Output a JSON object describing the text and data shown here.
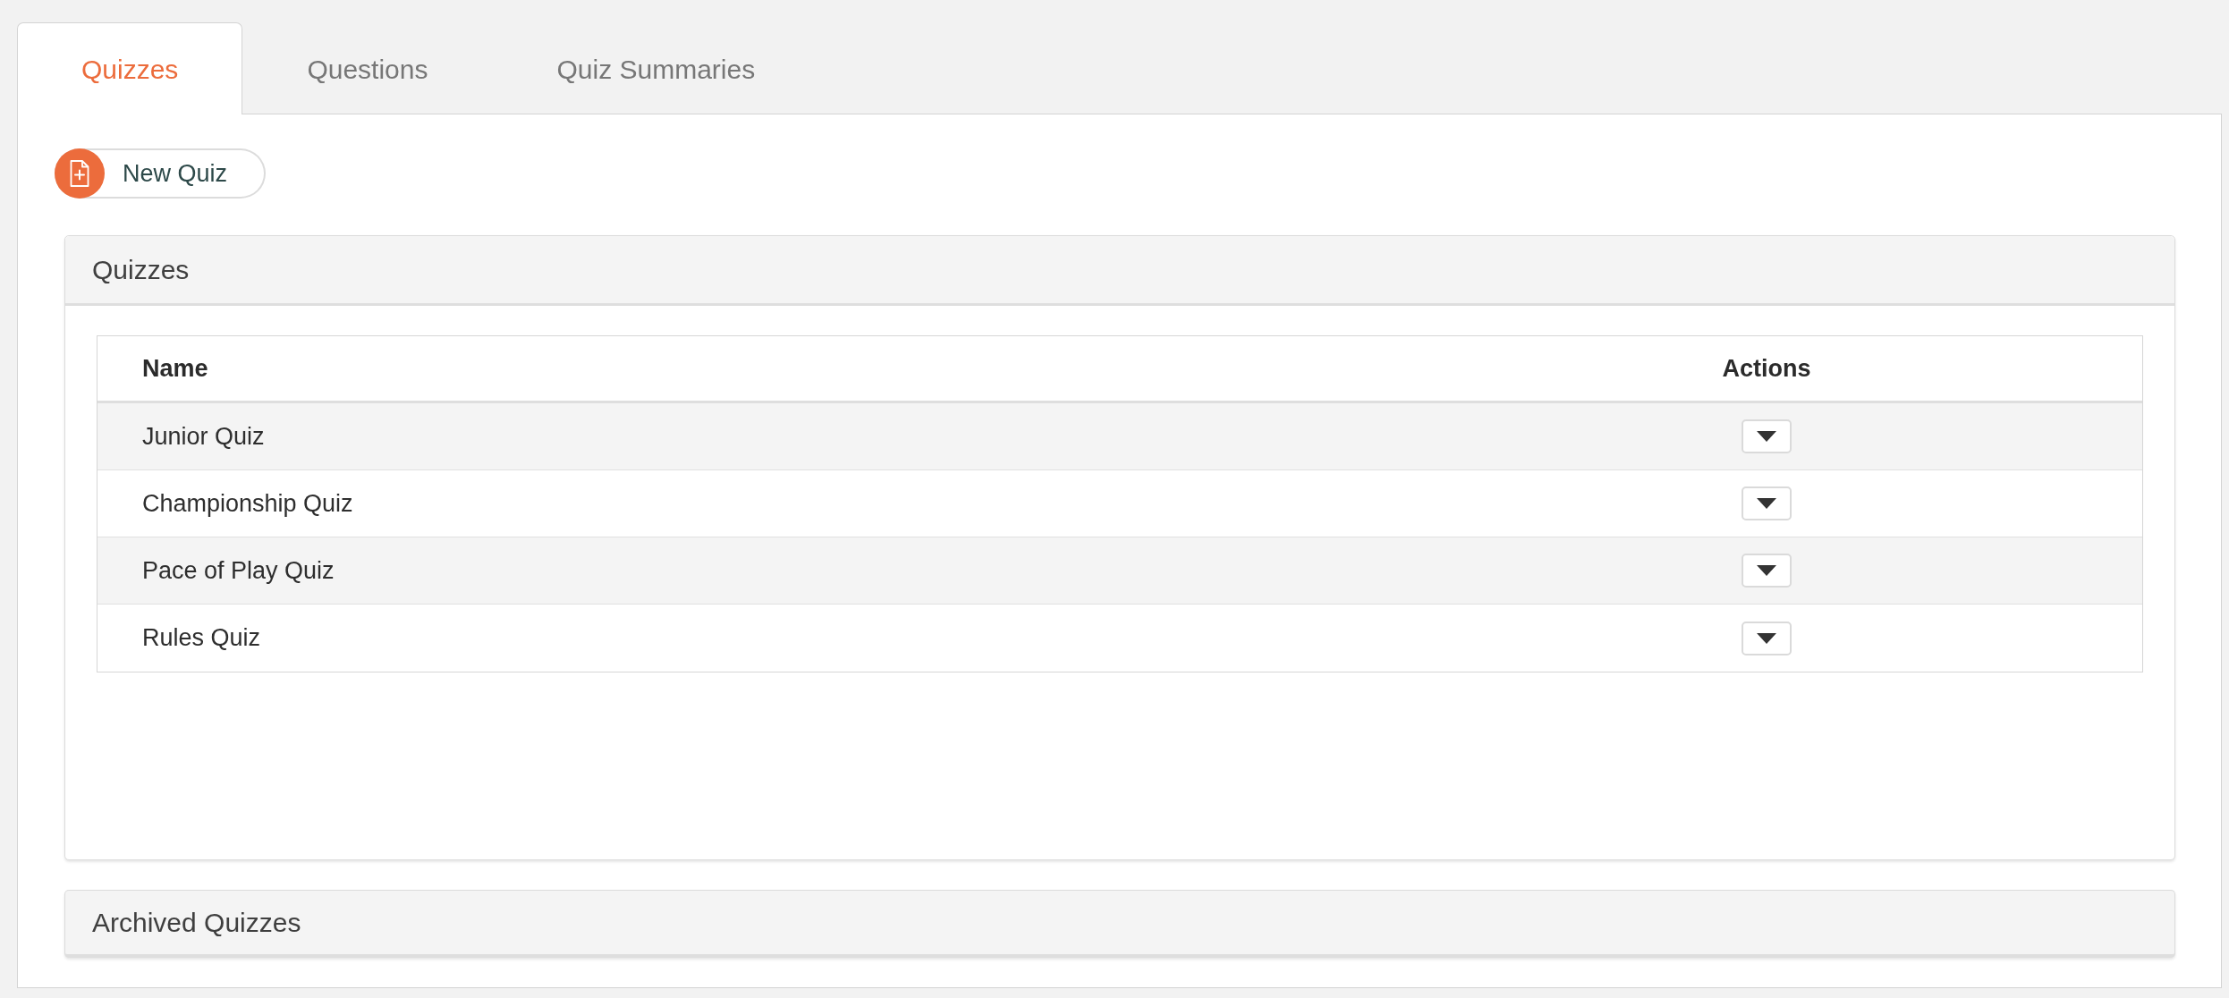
{
  "tabs": [
    {
      "label": "Quizzes",
      "selected": true
    },
    {
      "label": "Questions",
      "selected": false
    },
    {
      "label": "Quiz Summaries",
      "selected": false
    }
  ],
  "new_quiz_button": {
    "label": "New Quiz"
  },
  "quizzes_panel": {
    "title": "Quizzes",
    "table": {
      "columns": [
        "Name",
        "Actions"
      ],
      "rows": [
        {
          "name": "Junior Quiz"
        },
        {
          "name": "Championship Quiz"
        },
        {
          "name": "Pace of Play Quiz"
        },
        {
          "name": "Rules Quiz"
        }
      ]
    }
  },
  "archived_panel": {
    "title": "Archived Quizzes"
  }
}
